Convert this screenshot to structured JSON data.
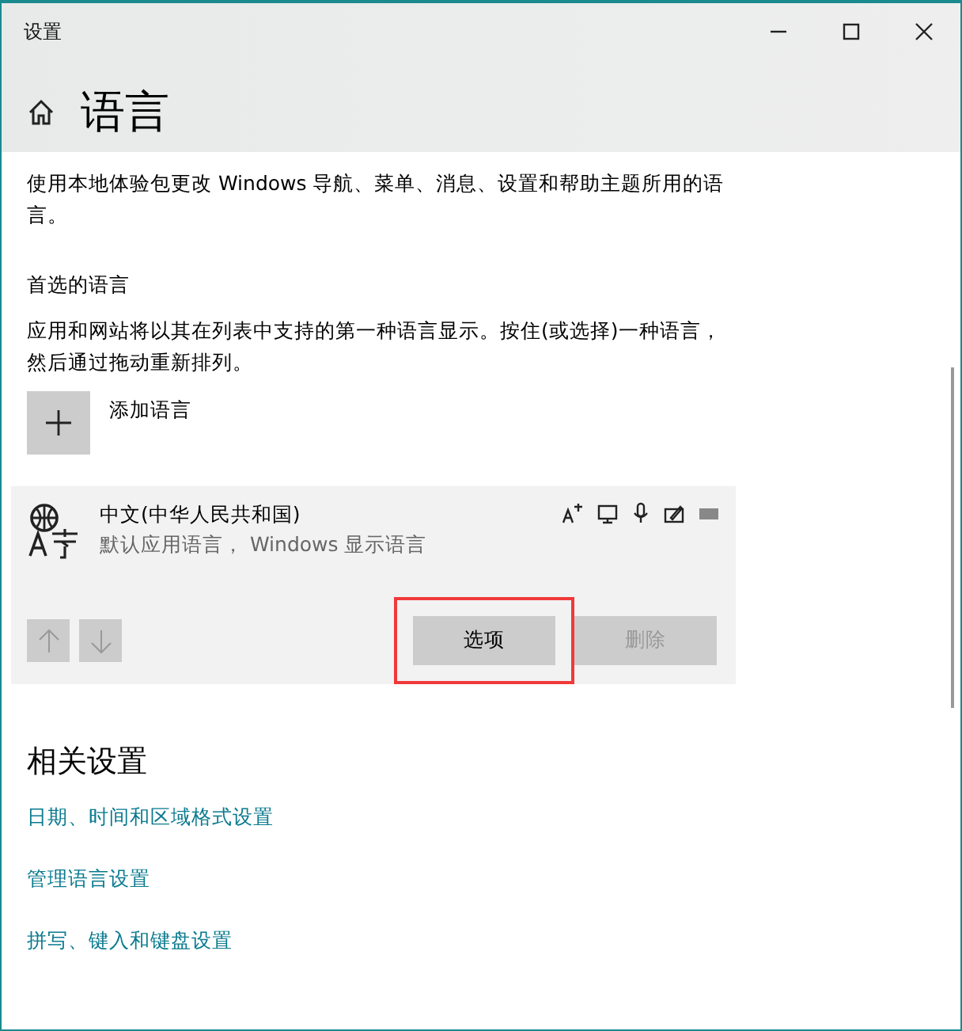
{
  "window": {
    "title": "设置"
  },
  "page": {
    "title": "语言",
    "description": "使用本地体验包更改 Windows 导航、菜单、消息、设置和帮助主题所用的语言。"
  },
  "preferred": {
    "heading": "首选的语言",
    "description": "应用和网站将以其在列表中支持的第一种语言显示。按住(或选择)一种语言，然后通过拖动重新排列。",
    "add_label": "添加语言"
  },
  "languages": [
    {
      "name": "中文(中华人民共和国)",
      "details": "默认应用语言， Windows 显示语言",
      "selected": true,
      "move_up": {
        "disabled": true
      },
      "move_down": {
        "disabled": true
      },
      "buttons": [
        {
          "label": "选项",
          "disabled": false,
          "highlighted": true
        },
        {
          "label": "删除",
          "disabled": true,
          "highlighted": false
        }
      ]
    }
  ],
  "related": {
    "heading": "相关设置",
    "links": [
      "日期、时间和区域格式设置",
      "管理语言设置",
      "拼写、键入和键盘设置"
    ]
  }
}
